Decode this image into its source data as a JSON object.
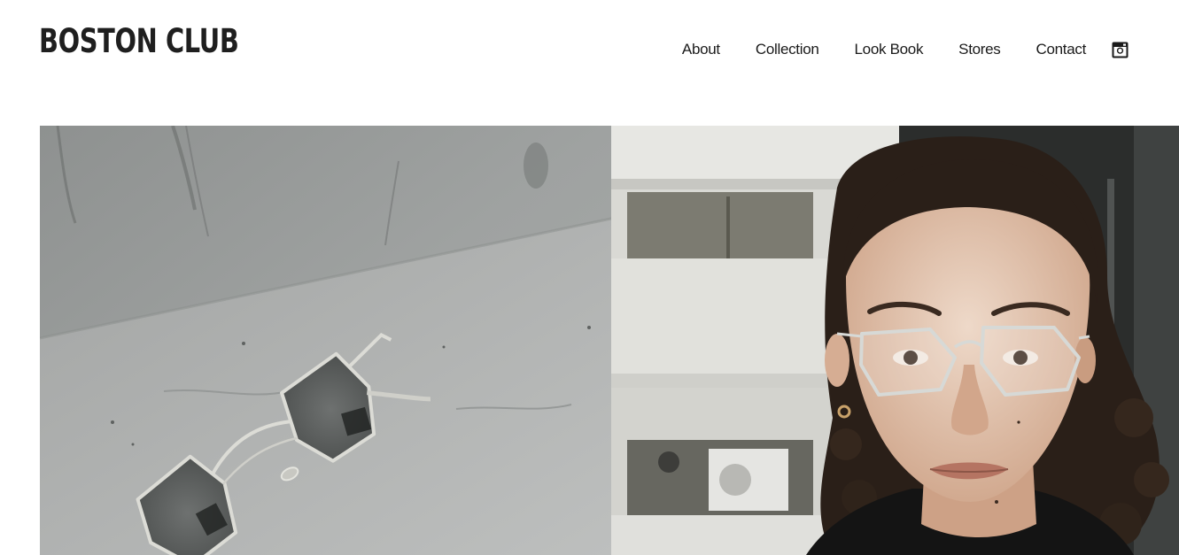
{
  "brand": {
    "logo_text": "BOSTON CLUB"
  },
  "nav": {
    "items": [
      {
        "label": "About"
      },
      {
        "label": "Collection"
      },
      {
        "label": "Look Book"
      },
      {
        "label": "Stores"
      },
      {
        "label": "Contact"
      }
    ],
    "instagram_icon": "instagram-icon"
  },
  "hero": {
    "left_image": "sunglasses-on-concrete",
    "right_image": "woman-wearing-glasses"
  },
  "colors": {
    "text": "#1a1a1a",
    "background": "#ffffff",
    "concrete": "#a9abaa",
    "building": "#d8d8d4"
  }
}
